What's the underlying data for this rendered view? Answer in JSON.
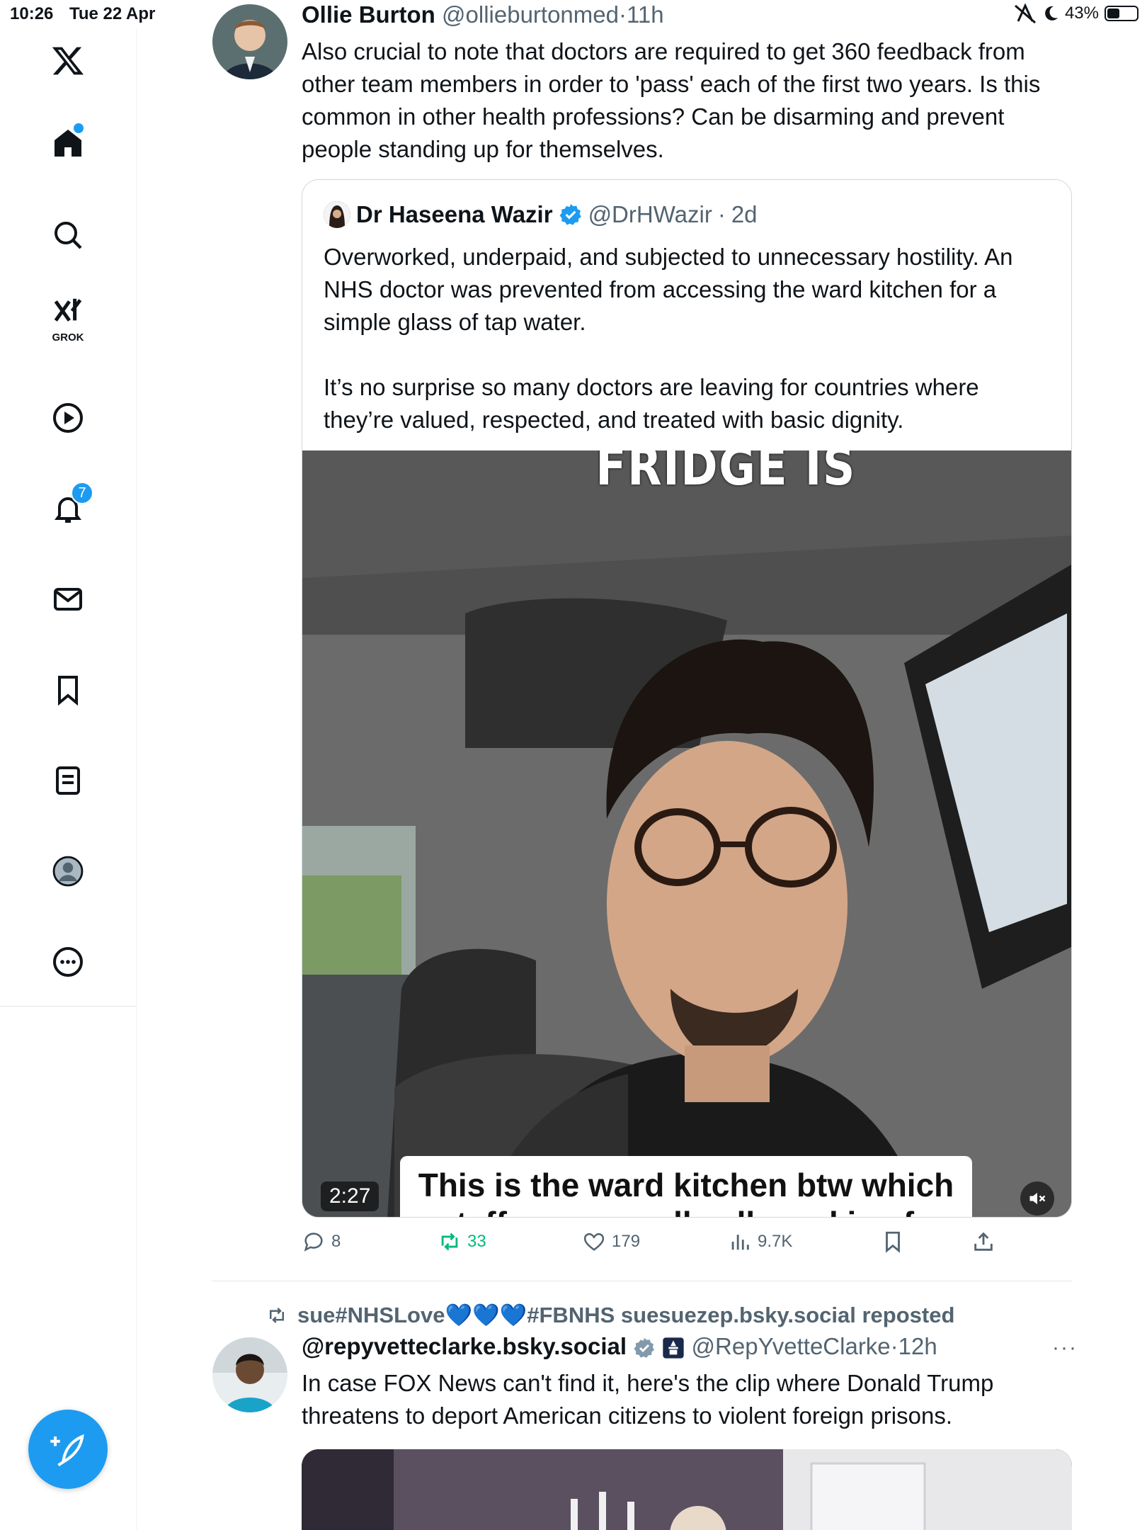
{
  "status_bar": {
    "time": "10:26",
    "date": "Tue 22 Apr",
    "battery": "43%",
    "battery_level": 0.43
  },
  "nav": {
    "grok_label": "GROK",
    "notification_count": "7"
  },
  "post1": {
    "name": "Ollie Burton",
    "handle": "@ollieburtonmed",
    "dot": "·",
    "time": "11h",
    "text_lines": [
      "Also crucial to note that doctors are required to get 360 feedback from",
      "other team members in order to 'pass' each of the first two years. Is this",
      "common in other health professions? Can be disarming and prevent",
      "people standing up for themselves."
    ],
    "quote": {
      "name": "Dr Haseena Wazir",
      "handle": "@DrHWazir",
      "dot": "·",
      "time": "2d",
      "para1_lines": [
        "Overworked, underpaid, and subjected to unnecessary hostility. An",
        "NHS doctor was prevented from accessing the ward kitchen for a",
        "simple glass of tap water."
      ],
      "para2_lines": [
        "It’s no surprise so many doctors are leaving for countries where",
        "they’re valued, respected, and treated with basic dignity."
      ],
      "video": {
        "overlay_text": "FRIDGE IS",
        "caption": "This is the ward kitchen btw which",
        "caption_line2": "staff are normally allowed in afo",
        "duration": "2:27"
      }
    },
    "actions": {
      "replies": "8",
      "reposts": "33",
      "likes": "179",
      "views": "9.7K"
    }
  },
  "post2": {
    "repost_label": "sue#NHSLove💙💙💙#FBNHS suesuezep.bsky.social reposted",
    "name": "@repyvetteclarke.bsky.social",
    "handle": "@RepYvetteClarke",
    "dot": "·",
    "time": "12h",
    "more": "···",
    "text_lines": [
      "In case FOX News can't find it, here's the clip where Donald Trump",
      "threatens to deport American citizens to violent foreign prisons."
    ]
  },
  "colors": {
    "accent": "#1d9bf0",
    "retweet": "#00ba7c",
    "muted": "#536471",
    "text": "#0f1419"
  },
  "icons": [
    "x-logo-icon",
    "home-icon",
    "search-icon",
    "grok-icon",
    "play-icon",
    "bell-icon",
    "mail-icon",
    "bookmark-icon",
    "list-icon",
    "profile-icon",
    "more-icon",
    "compose-icon"
  ]
}
